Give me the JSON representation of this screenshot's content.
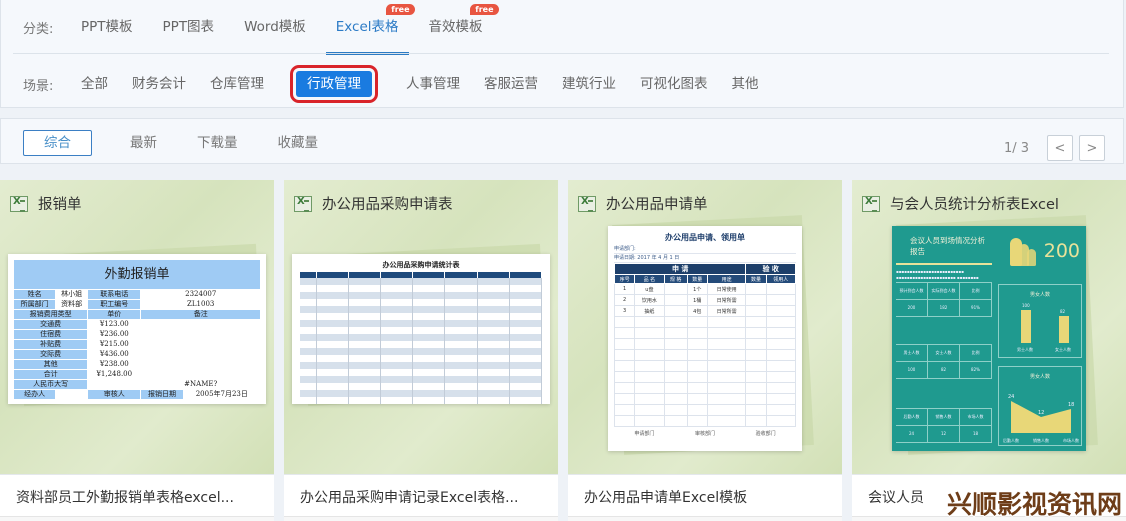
{
  "filters": {
    "category_label": "分类:",
    "categories": [
      {
        "label": "PPT模板",
        "active": false,
        "free": false
      },
      {
        "label": "PPT图表",
        "active": false,
        "free": false
      },
      {
        "label": "Word模板",
        "active": false,
        "free": false
      },
      {
        "label": "Excel表格",
        "active": true,
        "free": true
      },
      {
        "label": "音效模板",
        "active": false,
        "free": true
      }
    ],
    "free_badge": "free",
    "scene_label": "场景:",
    "scenes": [
      {
        "label": "全部",
        "active": false
      },
      {
        "label": "财务会计",
        "active": false
      },
      {
        "label": "仓库管理",
        "active": false
      },
      {
        "label": "行政管理",
        "active": true
      },
      {
        "label": "人事管理",
        "active": false
      },
      {
        "label": "客服运营",
        "active": false
      },
      {
        "label": "建筑行业",
        "active": false
      },
      {
        "label": "可视化图表",
        "active": false
      },
      {
        "label": "其他",
        "active": false
      }
    ]
  },
  "sort": {
    "options": [
      {
        "label": "综合",
        "active": true
      },
      {
        "label": "最新",
        "active": false
      },
      {
        "label": "下载量",
        "active": false
      },
      {
        "label": "收藏量",
        "active": false
      }
    ],
    "pager": {
      "text": "1/ 3",
      "prev": "<",
      "next": ">"
    }
  },
  "cards": [
    {
      "title": "报销单",
      "name": "资料部员工外勤报销单表格excel...",
      "preview": {
        "heading": "外勤报销单",
        "rows": [
          [
            "姓名",
            "林小姐",
            "联系电话",
            "2324007"
          ],
          [
            "所属部门",
            "资料部",
            "职工编号",
            "ZL1003"
          ],
          [
            "报销费用类型",
            "单价",
            "备注"
          ],
          [
            "交通费",
            "¥123.00"
          ],
          [
            "住宿费",
            "¥236.00"
          ],
          [
            "补贴费",
            "¥215.00"
          ],
          [
            "交际费",
            "¥436.00"
          ],
          [
            "其他",
            "¥238.00"
          ],
          [
            "合计",
            "¥1,248.00"
          ],
          [
            "人民币大写",
            "",
            "#NAME?"
          ],
          [
            "经办人",
            "审核人",
            "报销日期",
            "2005年7月23日"
          ]
        ]
      }
    },
    {
      "title": "办公用品采购申请表",
      "name": "办公用品采购申请记录Excel表格...",
      "preview": {
        "heading": "办公用品采购申请统计表"
      }
    },
    {
      "title": "办公用品申请单",
      "name": "办公用品申请单Excel模板",
      "preview": {
        "heading": "办公用品申请、领用单",
        "dept_label": "申请部门:",
        "date_line": "申请日期:  2017 年 4 月 1 日",
        "group_apply": "申  请",
        "group_check": "验  收",
        "cols": [
          "序号",
          "品 名",
          "规 格",
          "数量",
          "用途",
          "数量",
          "领用人"
        ],
        "rows": [
          [
            "1",
            "u盘",
            "",
            "1个",
            "日常使用"
          ],
          [
            "2",
            "饮用水",
            "",
            "1桶",
            "日常所需"
          ],
          [
            "3",
            "抽纸",
            "",
            "4包",
            "日常所需"
          ]
        ],
        "footer": [
          "申请部门",
          "审核部门",
          "验收部门"
        ]
      }
    },
    {
      "title": "与会人员统计分析表Excel",
      "name": "会议人员",
      "preview": {
        "heading": "会议人员到场情况分析报告",
        "total": "200",
        "box1_title": "男女人数",
        "box2_title": "男女人数",
        "bar_values": [
          {
            "label": "男士人数",
            "value": 100
          },
          {
            "label": "女士人数",
            "value": 82
          }
        ],
        "line_values": [
          {
            "label": "后勤人数",
            "value": 24
          },
          {
            "label": "销售人数",
            "value": 12
          },
          {
            "label": "市场人数",
            "value": 18
          }
        ],
        "grid1": [
          [
            "预计到会人数",
            "实际到会人数",
            "比例"
          ],
          [
            "200",
            "182",
            "91%"
          ]
        ],
        "grid2": [
          [
            "男士人数",
            "女士人数",
            "比例"
          ],
          [
            "100",
            "82",
            "82%"
          ]
        ],
        "grid3": [
          [
            "后勤人数",
            "销售人数",
            "市场人数"
          ],
          [
            "24",
            "12",
            "18"
          ]
        ]
      }
    }
  ],
  "watermark": "兴顺影视资讯网"
}
